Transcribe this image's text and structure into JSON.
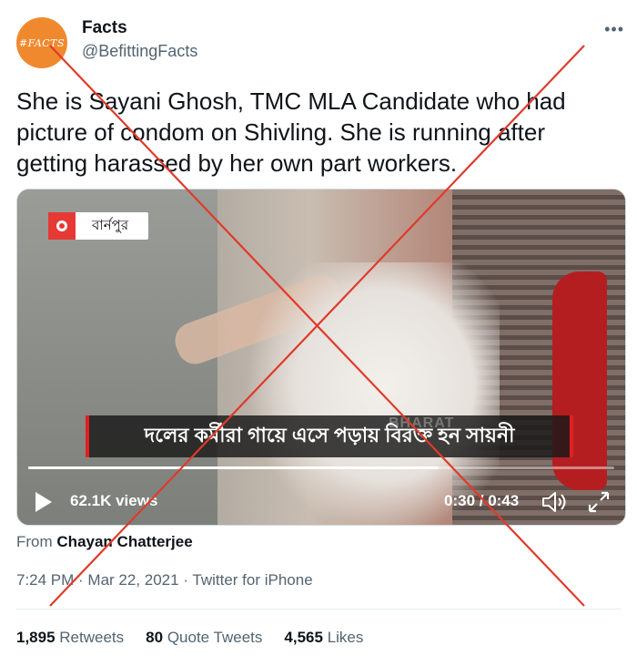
{
  "author": {
    "avatar_text": "#FACTS",
    "name": "Facts",
    "handle": "@BefittingFacts"
  },
  "more_label": "•••",
  "tweet": {
    "text": "She is Sayani Ghosh, TMC MLA Candidate who had picture of condom on Shivling. She is running after getting harassed by her own part workers."
  },
  "video": {
    "location_label": "বার্নপুর",
    "caption": "দলের কর্মীরা গায়ে এসে পড়ায় বিরক্ত হন সায়নী",
    "watermark": "BHARAT",
    "views": "62.1K views",
    "current_time": "0:30",
    "duration": "0:43",
    "timecode": "0:30 / 0:43",
    "progress_fraction": 0.7
  },
  "source": {
    "prefix": "From",
    "name": "Chayan Chatterjee"
  },
  "meta": {
    "time": "7:24 PM",
    "date": "Mar 22, 2021",
    "client": "Twitter for iPhone",
    "line": "7:24 PM · Mar 22, 2021 · Twitter for iPhone"
  },
  "stats": {
    "retweets_count": "1,895",
    "retweets_label": "Retweets",
    "quotes_count": "80",
    "quotes_label": "Quote Tweets",
    "likes_count": "4,565",
    "likes_label": "Likes"
  },
  "colors": {
    "cross": "#e03a2a",
    "avatar_bg": "#f0892e",
    "text_secondary": "#536471"
  }
}
